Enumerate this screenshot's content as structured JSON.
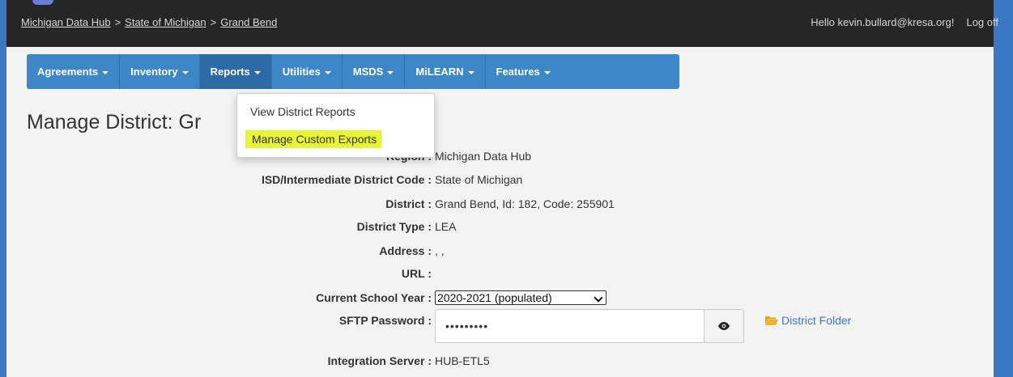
{
  "header": {
    "breadcrumbs": [
      "Michigan Data Hub",
      "State of Michigan",
      "Grand Bend"
    ],
    "separator": ">",
    "greeting": "Hello kevin.bullard@kresa.org!",
    "logoff": "Log off"
  },
  "nav": {
    "items": [
      {
        "label": "Agreements"
      },
      {
        "label": "Inventory"
      },
      {
        "label": "Reports"
      },
      {
        "label": "Utilities"
      },
      {
        "label": "MSDS"
      },
      {
        "label": "MiLEARN"
      },
      {
        "label": "Features"
      }
    ],
    "dropdown": {
      "items": [
        {
          "label": "View District Reports"
        },
        {
          "label": "Manage Custom Exports"
        }
      ]
    }
  },
  "page": {
    "title": "Manage District: Gr"
  },
  "details": {
    "region": {
      "label": "Region",
      "value": "Michigan Data Hub"
    },
    "isd": {
      "label": "ISD/Intermediate District Code",
      "value": "State of Michigan"
    },
    "district": {
      "label": "District",
      "value": "Grand Bend, Id: 182, Code: 255901"
    },
    "type": {
      "label": "District Type",
      "value": "LEA"
    },
    "address": {
      "label": "Address",
      "value": ", ,"
    },
    "url": {
      "label": "URL",
      "value": ""
    },
    "year": {
      "label": "Current School Year",
      "value": "2020-2021 (populated)"
    },
    "sftp": {
      "label": "SFTP Password",
      "value": "•••••••••"
    },
    "folder_link": "District Folder",
    "integration": {
      "label": "Integration Server",
      "value": "HUB-ETL5"
    }
  },
  "colors": {
    "nav": "#3d87c8",
    "highlight": "#e8f535",
    "topbar": "#262626"
  }
}
